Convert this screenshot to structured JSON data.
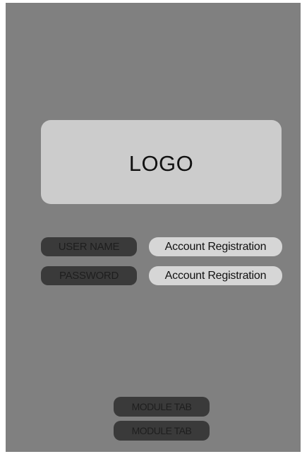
{
  "logo": {
    "text": "LOGO"
  },
  "login_form": {
    "username": {
      "label": "USER NAME",
      "value": "Account Registration"
    },
    "password": {
      "label": "PASSWORD",
      "value": "Account Registration"
    }
  },
  "module_tabs": [
    {
      "label": "MODULE TAB"
    },
    {
      "label": "MODULE TAB"
    }
  ],
  "colors": {
    "screen_background": "#808080",
    "logo_background": "#cccccc",
    "dark_pill": "#3a3a3a",
    "light_pill": "#d6d6d6"
  }
}
